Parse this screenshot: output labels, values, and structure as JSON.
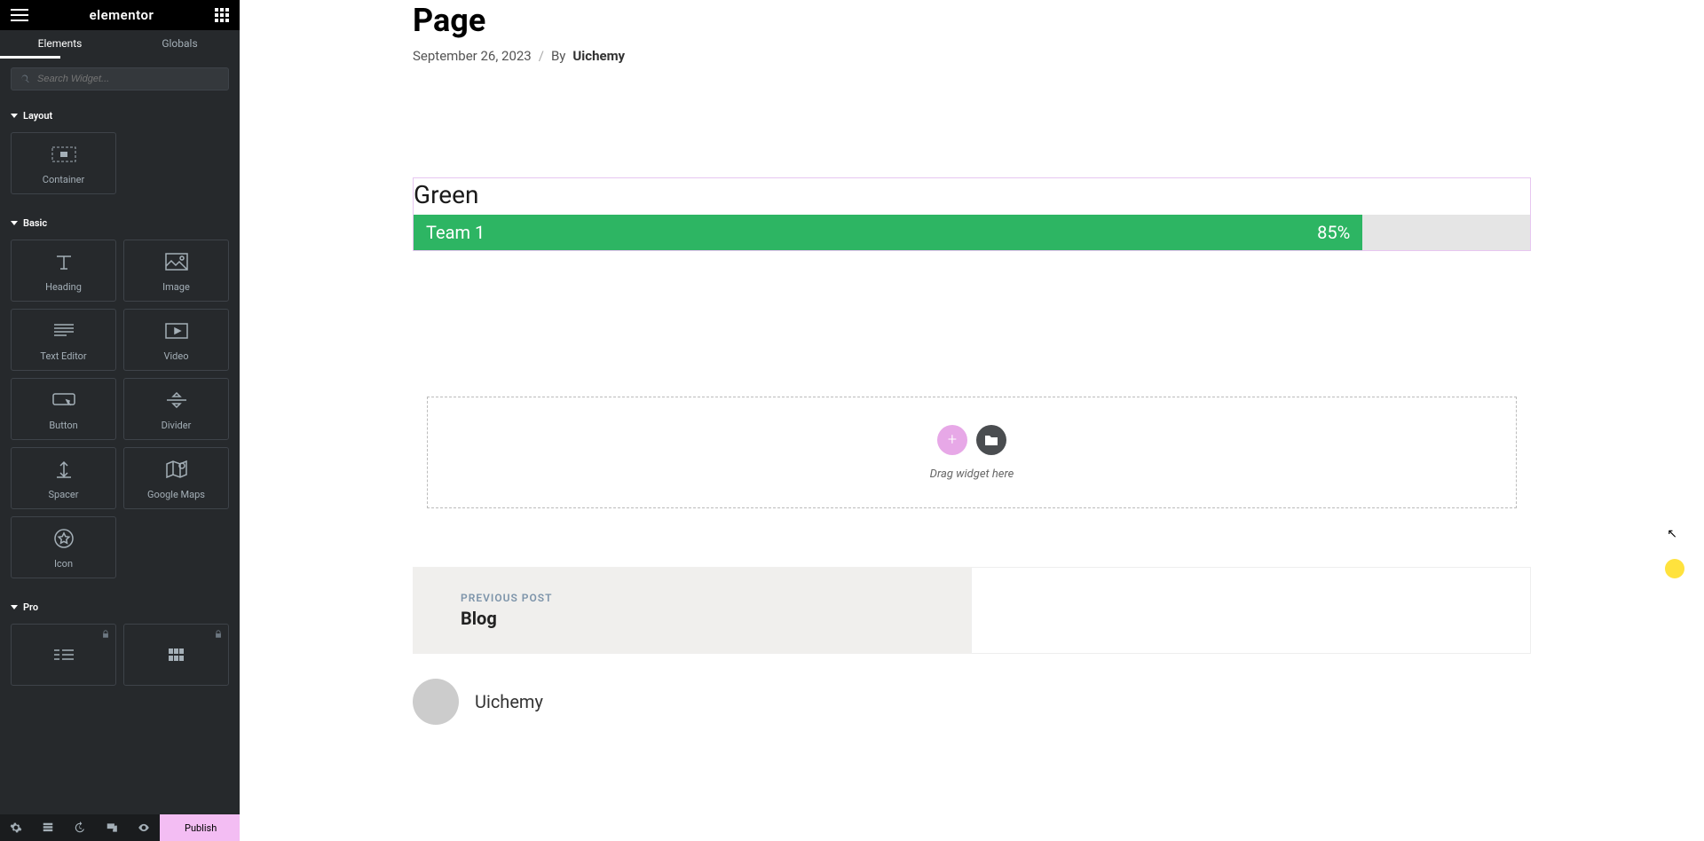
{
  "header": {
    "logo": "elementor"
  },
  "tabs": {
    "elements": "Elements",
    "globals": "Globals"
  },
  "search": {
    "placeholder": "Search Widget..."
  },
  "sections": {
    "layout": {
      "title": "Layout",
      "items": [
        {
          "label": "Container"
        }
      ]
    },
    "basic": {
      "title": "Basic",
      "items": [
        {
          "label": "Heading"
        },
        {
          "label": "Image"
        },
        {
          "label": "Text Editor"
        },
        {
          "label": "Video"
        },
        {
          "label": "Button"
        },
        {
          "label": "Divider"
        },
        {
          "label": "Spacer"
        },
        {
          "label": "Google Maps"
        },
        {
          "label": "Icon"
        }
      ]
    },
    "pro": {
      "title": "Pro"
    }
  },
  "footer": {
    "publish": "Publish"
  },
  "page": {
    "title": "Page",
    "date": "September 26, 2023",
    "byLabel": "By",
    "author": "Uichemy"
  },
  "progress": {
    "title": "Green",
    "innerLabel": "Team 1",
    "percent": "85%",
    "fillColor": "#2db563"
  },
  "dropZone": {
    "text": "Drag widget here"
  },
  "postNav": {
    "prev": {
      "label": "PREVIOUS POST",
      "title": "Blog"
    }
  },
  "authorBox": {
    "name": "Uichemy"
  }
}
